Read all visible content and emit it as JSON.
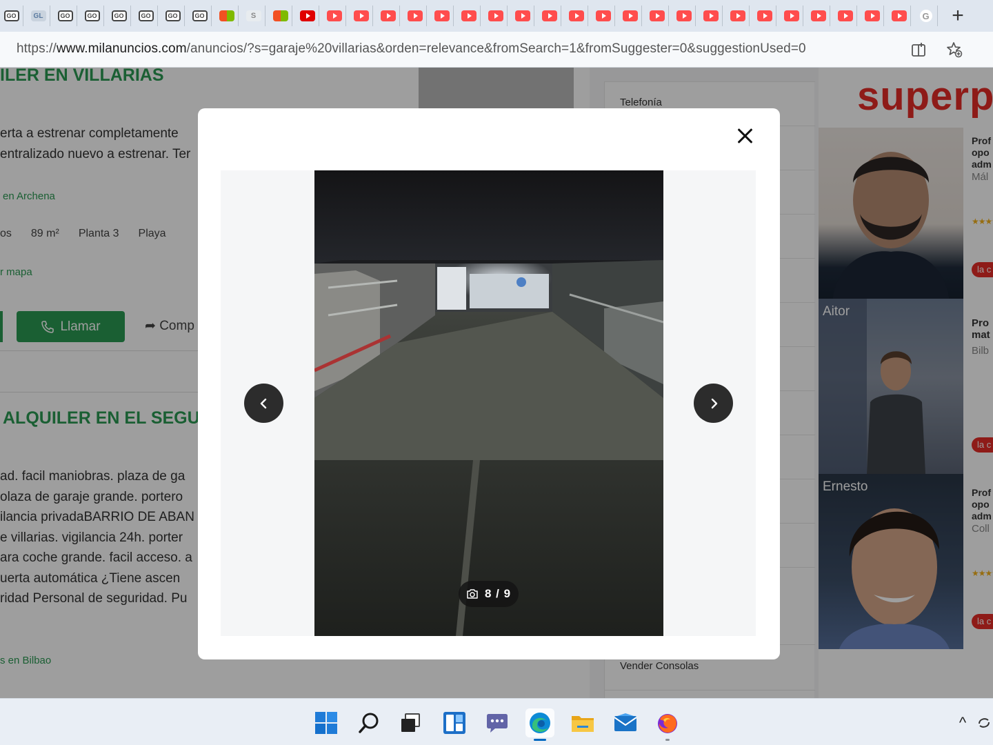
{
  "browser": {
    "tabs": [
      "oo",
      "gl",
      "oo",
      "oo",
      "oo",
      "oo",
      "oo",
      "oo",
      "ms",
      "sl",
      "ms",
      "yt-active",
      "yt",
      "yt",
      "yt",
      "yt",
      "yt",
      "yt",
      "yt",
      "yt",
      "yt",
      "yt",
      "yt",
      "yt",
      "yt",
      "yt",
      "yt",
      "yt",
      "yt",
      "yt",
      "yt",
      "yt",
      "yt",
      "yt",
      "gg"
    ],
    "tab_glyphs": {
      "oo": "GO",
      "gl": "GL",
      "sl": "S",
      "gg": "G"
    },
    "new_tab_label": "+",
    "url_prefix": "https://",
    "url_host": "www.milanuncios.com",
    "url_path": "/anuncios/?s=garaje%20villarias&orden=relevance&fromSearch=1&fromSuggester=0&suggestionUsed=0"
  },
  "listings": [
    {
      "title": "ILER EN VILLARIAS",
      "lines": [
        "erta a estrenar completamente",
        "entralizado nuevo a estrenar. Ter"
      ],
      "location": "en Archena",
      "tags": [
        "os",
        "89 m²",
        "Planta 3",
        "Playa"
      ],
      "map_link": "r mapa",
      "call_label": "Llamar",
      "share_label": "Comp"
    },
    {
      "title": "ALQUILER EN EL SEGUI",
      "lines": [
        "ad. facil maniobras. plaza de ga",
        "olaza de garaje grande. portero",
        "ilancia privadaBARRIO DE ABAN",
        "e villarias. vigilancia 24h. porter",
        "ara coche grande. facil acceso. a",
        "uerta automática ¿Tiene ascen",
        "ridad Personal de seguridad. Pu"
      ],
      "location": "s en Bilbao"
    }
  ],
  "sidebar": {
    "top_item": "Telefonía",
    "bottom_item": "Vender Consolas"
  },
  "ad": {
    "brand": "superp",
    "people": [
      {
        "name": "",
        "side_lines": [
          "Prof",
          "opo",
          "adm"
        ],
        "side_light": "Mál",
        "badge": "la c"
      },
      {
        "name": "Aitor",
        "side_lines": [
          "Pro",
          "mat"
        ],
        "side_light": "Bilb",
        "badge": "la c"
      },
      {
        "name": "Ernesto",
        "side_lines": [
          "Prof",
          "opo",
          "adm"
        ],
        "side_light": "Coll",
        "badge": "la c"
      }
    ]
  },
  "modal": {
    "counter": "8 / 9",
    "photo_subject": "dark underground parking garage ramp"
  },
  "taskbar": {
    "icons": [
      "windows-start-icon",
      "search-icon",
      "task-view-icon",
      "widgets-icon",
      "teams-chat-icon",
      "edge-icon",
      "file-explorer-icon",
      "mail-icon",
      "firefox-icon"
    ],
    "tray_chevron": "^"
  },
  "colors": {
    "brand_green": "#2b9a53",
    "ad_red": "#e52d27"
  }
}
